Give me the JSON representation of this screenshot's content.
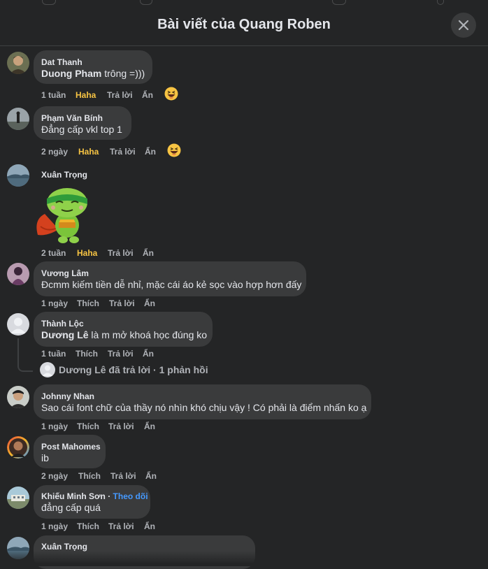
{
  "header": {
    "title": "Bài viết của Quang Roben"
  },
  "actions": {
    "reply": "Trả lời",
    "hide": "Ẩn",
    "like": "Thích",
    "haha": "Haha"
  },
  "comments": [
    {
      "author": "Dat Thanh",
      "mention": "Duong Pham",
      "text": " trông =)))",
      "time": "1 tuần",
      "reaction": "Haha"
    },
    {
      "author": "Phạm Văn Bính",
      "text": "Đẳng cấp vkl top 1",
      "time": "2 ngày",
      "reaction": "Haha"
    },
    {
      "author": "Xuân Trọng",
      "sticker": "turtle-superhero-sticker",
      "time": "2 tuần",
      "reaction": "Haha"
    },
    {
      "author": "Vương Lâm",
      "text": "Đcmm kiếm tiền dễ nhỉ, mặc cái áo kẻ sọc vào hợp hơn đấy",
      "time": "1 ngày",
      "reaction": "Thích"
    },
    {
      "author": "Thành Lộc",
      "mention": "Dương Lê",
      "text": " là m mở khoá học đúng ko",
      "time": "1 tuần",
      "reaction": "Thích",
      "reply_summary": "Dương Lê đã trả lời · 1 phản hồi"
    },
    {
      "author": "Johnny Nhan",
      "text": "Sao cái font chữ của thầy nó nhìn khó chịu vậy ! Có phải là điểm nhấn ko ạ",
      "time": "1 ngày",
      "reaction": "Thích"
    },
    {
      "author": "Post Mahomes",
      "text": "ib",
      "time": "2 ngày",
      "reaction": "Thích"
    },
    {
      "author": "Khiếu Minh Sơn",
      "follow": "Theo dõi",
      "text": "đẳng cấp quá",
      "time": "1 ngày",
      "reaction": "Thích"
    },
    {
      "author": "Xuân Trọng",
      "text": ""
    }
  ],
  "colors": {
    "background": "#242526",
    "bubble": "#3a3b3c",
    "haha": "#f7c443",
    "follow": "#4599ff"
  }
}
